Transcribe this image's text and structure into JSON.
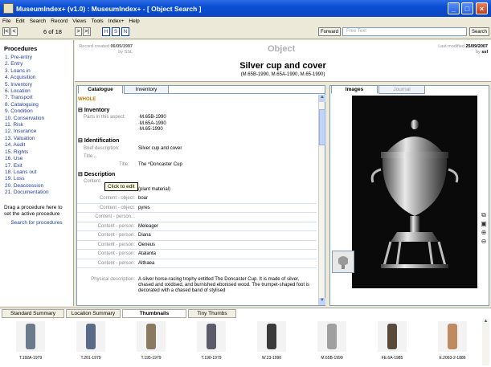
{
  "window": {
    "title": "MuseumIndex+ (v1.0) : MuseumIndex+ - [ Object Search ]"
  },
  "menu": [
    "File",
    "Edit",
    "Search",
    "Record",
    "Views",
    "Tools",
    "Index+",
    "Help"
  ],
  "toolbar": {
    "first": "|<",
    "prev": "<",
    "counter": "6 of 18",
    "next": ">",
    "last": ">|",
    "h": "H",
    "s": "S",
    "n": "N",
    "forward": "Forward",
    "free_text": "Free Text",
    "search": "Search"
  },
  "sidebar": {
    "heading": "Procedures",
    "items": [
      "1. Pre-entry",
      "2. Entry",
      "3. Loans in",
      "4. Acquisition",
      "5. Inventory",
      "6. Location",
      "7. Transport",
      "8. Cataloguing",
      "9. Condition",
      "10. Conservation",
      "11. Risk",
      "12. Insurance",
      "13. Valuation",
      "14. Audit",
      "15. Rights",
      "16. Use",
      "17. Exit",
      "18. Loans out",
      "19. Loss",
      "20. Deaccession",
      "21. Documentation"
    ],
    "hint": "Drag a procedure here to set the active procedure",
    "search": "Search for procedures"
  },
  "header": {
    "created_label": "Record created",
    "created_date": "06/05/1997",
    "created_by_label": "by",
    "created_by": "SSL",
    "section": "Object",
    "modified_label": "Last modified",
    "modified_date": "25/09/2007",
    "modified_by_label": "by",
    "modified_by": "ssl",
    "title": "Silver cup and cover",
    "numbers": "(M.65B-1990, M.65A-1990, M.65-1990)"
  },
  "form": {
    "tabs": [
      "Catalogue",
      "Inventory"
    ],
    "whole": "WHOLE",
    "inventory_heading": "Inventory",
    "parts_label": "Parts in this aspect:",
    "parts": [
      "M.65B-1990",
      "M.65A-1990",
      "M.65-1990"
    ],
    "ident_heading": "Identification",
    "brief_label": "Brief description:",
    "brief_value": "Silver cup and cover",
    "title_label": "Title...",
    "title_sub_label": "Title:",
    "title_value": "The ^Doncaster Cup",
    "desc_heading": "Description",
    "tooltip": "Click to edit",
    "content_label": "Content",
    "content_plant": "(plant material)",
    "rows": [
      {
        "label": "Content - object:",
        "value": "boar"
      },
      {
        "label": "Content - object:",
        "value": "pyres"
      },
      {
        "label": "Content - person...",
        "value": ""
      },
      {
        "label": "Content - person:",
        "value": "Meleager"
      },
      {
        "label": "Content - person:",
        "value": "Diana"
      },
      {
        "label": "Content - person:",
        "value": "Oeneus"
      },
      {
        "label": "Content - person:",
        "value": "Atalanta"
      },
      {
        "label": "Content - person:",
        "value": "Althaea"
      }
    ],
    "phys_label": "Physical description:",
    "phys_value": "A silver horse-racing trophy entitled The Doncaster Cup. It is made of silver, chased and oxidised, and burnished ebonised wood. The trumpet-shaped foot is decorated with a chased band of stylised"
  },
  "images": {
    "tabs": [
      "Images",
      "Journal"
    ]
  },
  "bottom": {
    "tabs": [
      "Standard Summary",
      "Location Summary",
      "Thumbnails",
      "Tiny Thumbs"
    ],
    "thumbs": [
      "T.192A-1979",
      "T.201-1979",
      "T.195-1979",
      "T.190-1979",
      "W.23-1990",
      "M.65B-1990",
      "FE.6A-1985",
      "E.2063-2-1886"
    ]
  }
}
